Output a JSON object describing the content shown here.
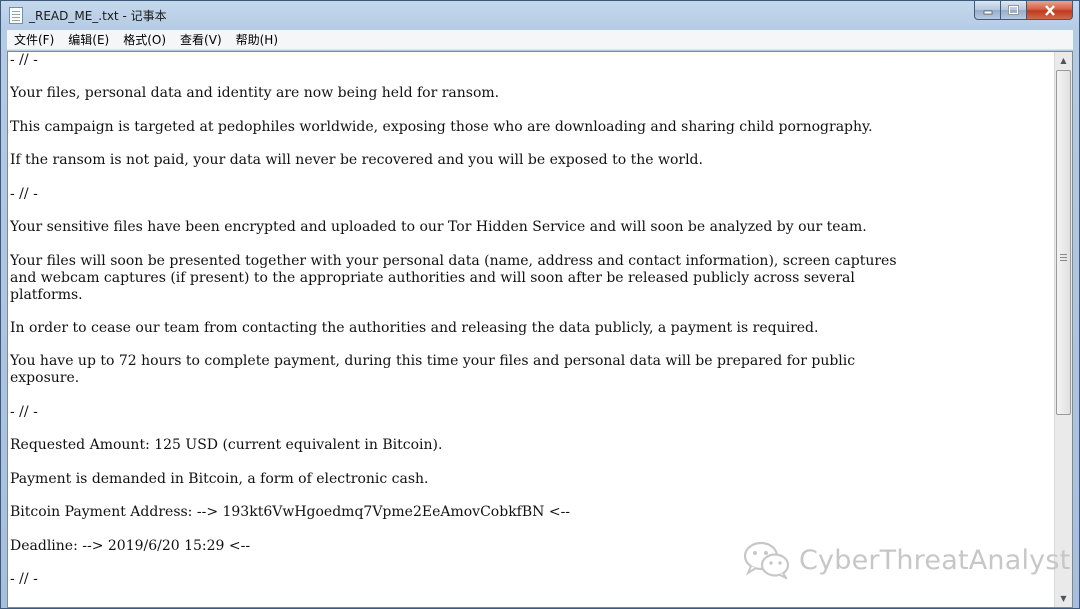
{
  "window": {
    "title": "_READ_ME_.txt - 记事本",
    "controls": {
      "minimize": "minimize",
      "maximize": "maximize",
      "close": "close"
    }
  },
  "menubar": {
    "items": [
      {
        "label": "文件(F)"
      },
      {
        "label": "编辑(E)"
      },
      {
        "label": "格式(O)"
      },
      {
        "label": "查看(V)"
      },
      {
        "label": "帮助(H)"
      }
    ]
  },
  "document": {
    "lines": [
      "- // -",
      "",
      "Your files, personal data and identity are now being held for ransom.",
      "",
      "This campaign is targeted at pedophiles worldwide, exposing those who are downloading and sharing child pornography.",
      "",
      "If the ransom is not paid, your data will never be recovered and you will be exposed to the world.",
      "",
      "- // -",
      "",
      "Your sensitive files have been encrypted and uploaded to our Tor Hidden Service and will soon be analyzed by our team.",
      "",
      "Your files will soon be presented together with your personal data (name, address and contact information), screen captures",
      "and webcam captures (if present) to the appropriate authorities and will soon after be released publicly across several",
      "platforms.",
      "",
      "In order to cease our team from contacting the authorities and releasing the data publicly, a payment is required.",
      "",
      "You have up to 72 hours to complete payment, during this time your files and personal data will be prepared for public",
      "exposure.",
      "",
      "- // -",
      "",
      "Requested Amount: 125 USD (current equivalent in Bitcoin).",
      "",
      "Payment is demanded in Bitcoin, a form of electronic cash.",
      "",
      "Bitcoin Payment Address: --> 193kt6VwHgoedmq7Vpme2EeAmovCobkfBN <--",
      "",
      "Deadline: --> 2019/6/20 15:29 <--",
      "",
      "- // -"
    ]
  },
  "scrollbar": {
    "position": 0.0
  },
  "watermark": {
    "text": "CyberThreatAnalyst",
    "icon": "wechat-icon"
  },
  "colors": {
    "titlebar": "#b4cbe4",
    "close_button": "#c0391c",
    "editor_bg": "#ffffff"
  }
}
